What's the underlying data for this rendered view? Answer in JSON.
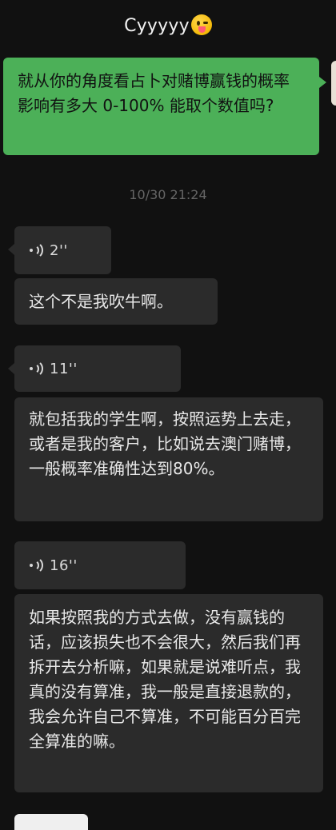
{
  "header": {
    "title": "Cyyyyy",
    "emoji_icon": "tongue-out-emoji"
  },
  "messages": {
    "outgoing_1": "就从你的角度看占卜对赌博赢钱的概率 影响有多大 0-100% 能取个数值吗?",
    "timestamp": "10/30 21:24",
    "voice_1": "2''",
    "text_1": "这个不是我吹牛啊。",
    "voice_2": "11''",
    "text_2": "就包括我的学生啊，按照运势上去走，或者是我的客户，比如说去澳门赌博，一般概率准确性达到80%。",
    "voice_3": "16''",
    "text_3": "如果按照我的方式去做，没有赢钱的话，应该损失也不会很大，然后我们再拆开去分析嘛，如果就是说难听点，我真的没有算准，我一般是直接退款的，我会允许自己不算准，不可能百分百完全算准的嘛。"
  },
  "colors": {
    "background": "#111111",
    "outgoing_bubble": "#4cb058",
    "incoming_bubble": "#2b2b2b",
    "timestamp": "#666666"
  }
}
